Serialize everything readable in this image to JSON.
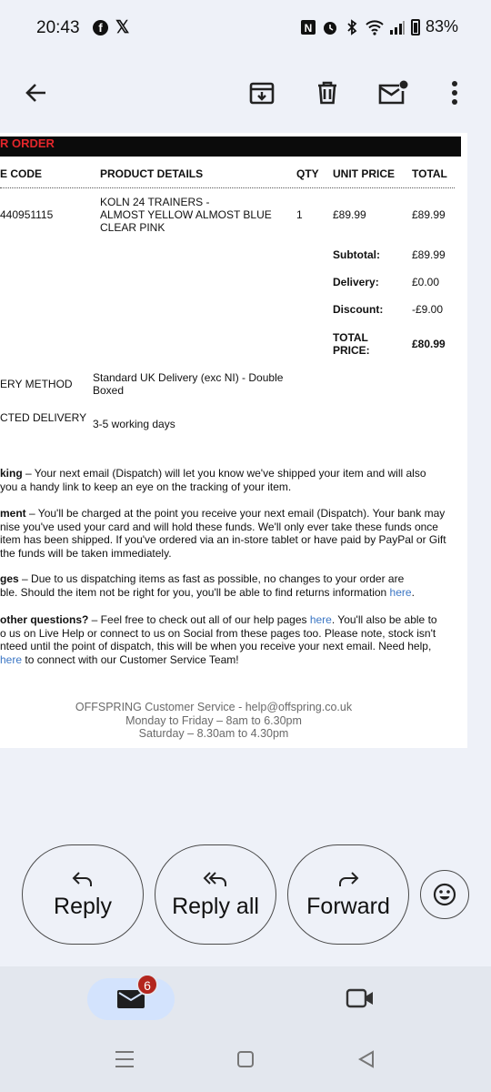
{
  "status": {
    "time": "20:43",
    "battery": "83%",
    "fb_icon": "f",
    "x_icon": "𝕏"
  },
  "toolbar": {
    "back": "back-arrow-icon",
    "archive": "archive-icon",
    "delete": "trash-icon",
    "mark_unread": "mark-unread-icon",
    "more": "more-vert-icon"
  },
  "email": {
    "order_heading": "R ORDER",
    "table_headers": {
      "code": "E CODE",
      "details": "PRODUCT DETAILS",
      "qty": "QTY",
      "unit": "UNIT PRICE",
      "total": "TOTAL"
    },
    "item": {
      "code": "440951115",
      "details": [
        "KOLN 24 TRAINERS -",
        "ALMOST YELLOW ALMOST BLUE",
        "CLEAR PINK"
      ],
      "qty": "1",
      "unit": "£89.99",
      "total": "£89.99"
    },
    "totals": {
      "subtotal_label": "Subtotal:",
      "subtotal": "£89.99",
      "delivery_label": "Delivery:",
      "delivery": "£0.00",
      "discount_label": "Discount:",
      "discount": "-£9.00",
      "total_label_1": "TOTAL",
      "total_label_2": "PRICE:",
      "total": "£80.99"
    },
    "delivery_method_label": "ERY METHOD",
    "delivery_method": [
      "Standard UK Delivery (exc NI) - Double",
      "Boxed"
    ],
    "expected_label": "CTED DELIVERY",
    "expected": "3-5 working days",
    "tracking": {
      "title": "king",
      "l1": " – Your next email (Dispatch) will let you know we've shipped your item and will also",
      "l2": "you a handy link to keep an eye on the tracking of your item."
    },
    "payment": {
      "title": "ment",
      "l1": " – You'll be charged at the point you receive your next email (Dispatch). Your bank may",
      "l2": "nise you've used your card and will hold these funds. We'll only ever take these funds once",
      "l3": "item has been shipped. If you've ordered via an in-store tablet or have paid by PayPal or Gift",
      "l4": "the funds will be taken immediately."
    },
    "changes": {
      "title": "ges",
      "l1": " – Due to us dispatching items as fast as possible, no changes to your order are",
      "l2": "ble. Should the item not be right for you, you'll be able to find returns information ",
      "link": "here",
      "end": "."
    },
    "questions": {
      "title": "other questions?",
      "l1a": " – Feel free to check out all of our help pages ",
      "link1": "here",
      "l1b": ". You'll also be able to",
      "l2": "o us on Live Help or connect to us on Social from these pages too. Please note, stock isn't",
      "l3": "nteed until the point of dispatch, this will be when you receive your next email. Need help,",
      "link2": "here",
      "l4": " to connect with our Customer Service Team!"
    },
    "footer": {
      "line1": "OFFSPRING Customer Service - help@offspring.co.uk",
      "line2": "Monday to Friday – 8am to 6.30pm",
      "line3": "Saturday – 8.30am to 4.30pm"
    }
  },
  "actions": {
    "reply": "Reply",
    "reply_all": "Reply all",
    "forward": "Forward"
  },
  "nav": {
    "mail_badge": "6"
  }
}
